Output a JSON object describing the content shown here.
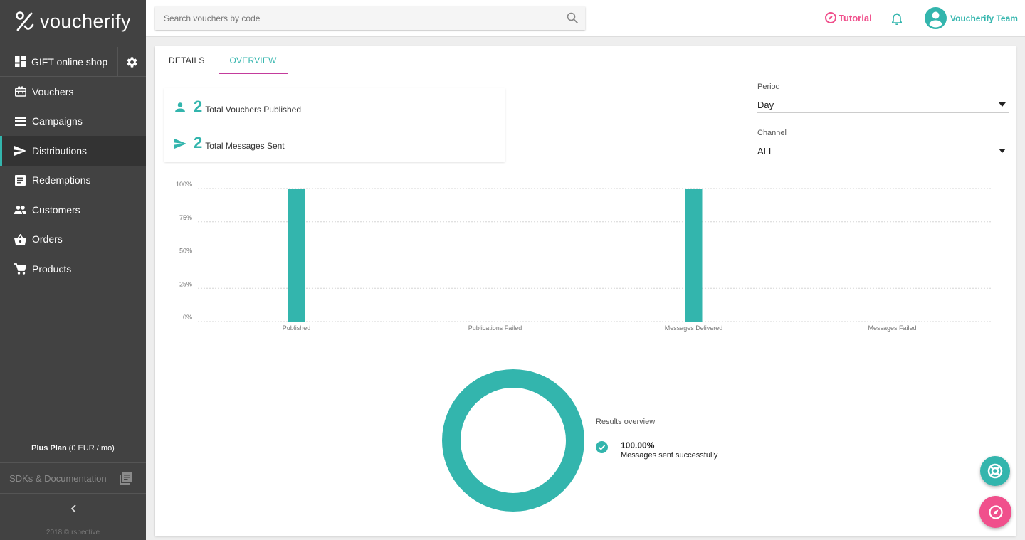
{
  "brand": {
    "name": "voucherify",
    "accent": "#33b5ad",
    "pink": "#f0508c"
  },
  "sidebar": {
    "shop": {
      "label": "GIFT online shop",
      "icon": "dashboard-icon"
    },
    "items": [
      {
        "label": "Vouchers",
        "icon": "gift-card-icon",
        "active": false
      },
      {
        "label": "Campaigns",
        "icon": "list-icon",
        "active": false
      },
      {
        "label": "Distributions",
        "icon": "send-icon",
        "active": true
      },
      {
        "label": "Redemptions",
        "icon": "receipt-icon",
        "active": false
      },
      {
        "label": "Customers",
        "icon": "people-icon",
        "active": false
      },
      {
        "label": "Orders",
        "icon": "basket-icon",
        "active": false
      },
      {
        "label": "Products",
        "icon": "cart-icon",
        "active": false
      }
    ],
    "plan_name": "Plus Plan",
    "plan_price": "(0 EUR / mo)",
    "sdk_label": "SDKs & Documentation",
    "copyright": "2018 © rspective"
  },
  "header": {
    "search_placeholder": "Search vouchers by code",
    "tutorial_label": "Tutorial",
    "user_name": "Voucherify Team"
  },
  "tabs": [
    {
      "label": "DETAILS",
      "active": false
    },
    {
      "label": "OVERVIEW",
      "active": true
    }
  ],
  "stats": [
    {
      "value": "2",
      "label": "Total Vouchers Published",
      "icon": "person-icon"
    },
    {
      "value": "2",
      "label": "Total Messages Sent",
      "icon": "send-icon"
    }
  ],
  "filters": {
    "period_label": "Period",
    "period_value": "Day",
    "channel_label": "Channel",
    "channel_value": "ALL"
  },
  "chart_data": [
    {
      "type": "bar",
      "categories": [
        "Published",
        "Publications Failed",
        "Messages Delivered",
        "Messages Failed"
      ],
      "values": [
        100,
        0,
        100,
        0
      ],
      "yticks": [
        "100%",
        "75%",
        "50%",
        "25%",
        "0%"
      ],
      "ylim": [
        0,
        100
      ],
      "grid": true,
      "color": "#33b5ad"
    },
    {
      "type": "pie",
      "title": "Results overview",
      "slices": [
        {
          "label": "Messages sent successfully",
          "value": 100.0,
          "display": "100.00%",
          "color": "#33b5ad"
        }
      ]
    }
  ]
}
